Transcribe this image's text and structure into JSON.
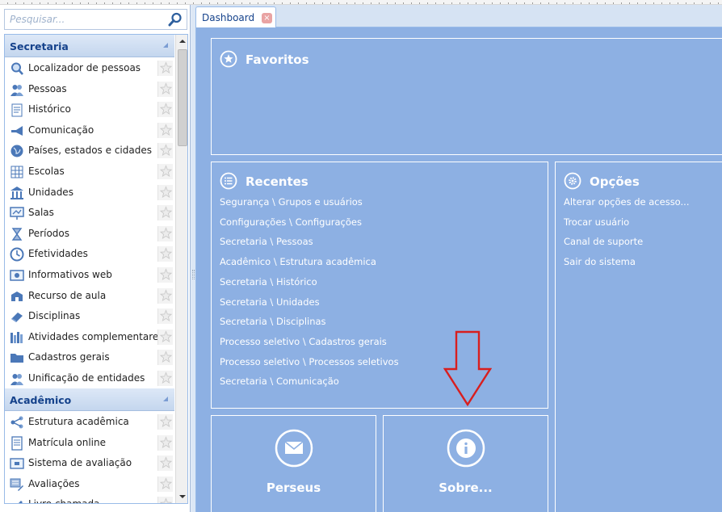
{
  "search": {
    "placeholder": "Pesquisar..."
  },
  "sidebar": {
    "sections": [
      {
        "title": "Secretaria",
        "items": [
          {
            "label": "Localizador de pessoas",
            "icon": "magnifier-icon"
          },
          {
            "label": "Pessoas",
            "icon": "people-icon"
          },
          {
            "label": "Histórico",
            "icon": "history-doc-icon"
          },
          {
            "label": "Comunicação",
            "icon": "megaphone-icon"
          },
          {
            "label": "Países, estados e cidades",
            "icon": "globe-icon"
          },
          {
            "label": "Escolas",
            "icon": "school-grid-icon"
          },
          {
            "label": "Unidades",
            "icon": "building-icon"
          },
          {
            "label": "Salas",
            "icon": "classroom-board-icon"
          },
          {
            "label": "Períodos",
            "icon": "hourglass-icon"
          },
          {
            "label": "Efetividades",
            "icon": "clock-icon"
          },
          {
            "label": "Informativos web",
            "icon": "web-info-icon"
          },
          {
            "label": "Recurso de aula",
            "icon": "classroom-resource-icon"
          },
          {
            "label": "Disciplinas",
            "icon": "books-icon"
          },
          {
            "label": "Atividades complementares",
            "icon": "activities-icon"
          },
          {
            "label": "Cadastros gerais",
            "icon": "folder-icon"
          },
          {
            "label": "Unificação de entidades",
            "icon": "merge-people-icon"
          }
        ]
      },
      {
        "title": "Acadêmico",
        "items": [
          {
            "label": "Estrutura acadêmica",
            "icon": "structure-icon"
          },
          {
            "label": "Matrícula online",
            "icon": "enrollment-doc-icon"
          },
          {
            "label": "Sistema de avaliação",
            "icon": "evaluation-icon"
          },
          {
            "label": "Avaliações",
            "icon": "assessments-icon"
          },
          {
            "label": "Livro chamada",
            "icon": "attendance-book-icon"
          }
        ]
      }
    ]
  },
  "tabs": [
    {
      "label": "Dashboard",
      "closable": true
    }
  ],
  "dashboard": {
    "favoritos": {
      "title": "Favoritos"
    },
    "recentes": {
      "title": "Recentes",
      "links": [
        "Segurança \\ Grupos e usuários",
        "Configurações \\ Configurações",
        "Secretaria \\ Pessoas",
        "Acadêmico \\ Estrutura acadêmica",
        "Secretaria \\ Histórico",
        "Secretaria \\ Unidades",
        "Secretaria \\ Disciplinas",
        "Processo seletivo \\ Cadastros gerais",
        "Processo seletivo \\ Processos seletivos",
        "Secretaria \\ Comunicação"
      ]
    },
    "opcoes": {
      "title": "Opções",
      "links": [
        "Alterar opções de acesso...",
        "Trocar usuário",
        "Canal de suporte",
        "Sair do sistema"
      ]
    },
    "perseus": {
      "label": "Perseus"
    },
    "sobre": {
      "label": "Sobre..."
    }
  },
  "colors": {
    "accent": "#15428b",
    "dashboard_bg": "#8db0e3",
    "annotation_arrow": "#d81e1e",
    "tab_close": "#e9a3a3"
  }
}
